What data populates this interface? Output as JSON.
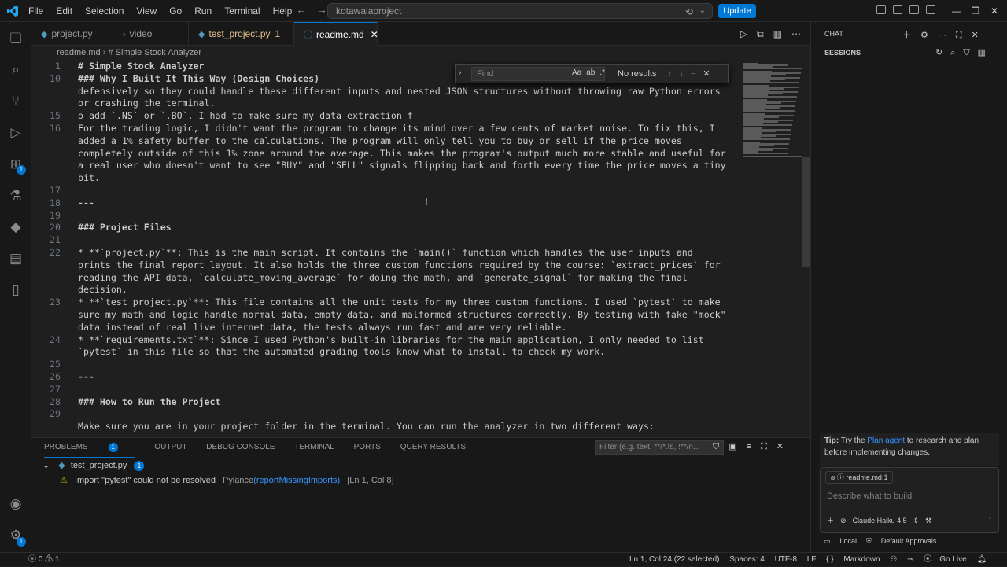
{
  "menu": [
    "File",
    "Edit",
    "Selection",
    "View",
    "Go",
    "Run",
    "Terminal",
    "Help"
  ],
  "search_text": "kotawalaproject",
  "update_label": "Update",
  "tabs": [
    {
      "label": "project.py"
    },
    {
      "label": "video"
    },
    {
      "label": "test_project.py",
      "badge": "1"
    },
    {
      "label": "readme.md"
    }
  ],
  "breadcrumb": {
    "file": "readme.md",
    "section": "# Simple Stock Analyzer"
  },
  "find": {
    "placeholder": "Find",
    "result": "No results",
    "opt_case": "Aa",
    "opt_word": "ab",
    "opt_regex": ".*"
  },
  "code_lines": [
    {
      "no": "1",
      "text": "# Simple Stock Analyzer",
      "style": "hd"
    },
    {
      "no": "10",
      "text": "### Why I Built It This Way (Design Choices)",
      "style": "hd"
    },
    {
      "no": "",
      "text": "defensively so they could handle these different inputs and nested JSON structures without throwing raw Python errors",
      "style": ""
    },
    {
      "no": "",
      "text": "or crashing the terminal.",
      "style": ""
    },
    {
      "no": "15",
      "text": "o add `.NS` or `.BO`. I had to make sure my data extraction f",
      "style": ""
    },
    {
      "no": "16",
      "text": "For the trading logic, I didn't want the program to change its mind over a few cents of market noise. To fix this, I",
      "style": ""
    },
    {
      "no": "",
      "text": "added a 1% safety buffer to the calculations. The program will only tell you to buy or sell if the price moves",
      "style": ""
    },
    {
      "no": "",
      "text": "completely outside of this 1% zone around the average. This makes the program's output much more stable and useful for",
      "style": ""
    },
    {
      "no": "",
      "text": "a real user who doesn't want to see \"BUY\" and \"SELL\" signals flipping back and forth every time the price moves a tiny",
      "style": ""
    },
    {
      "no": "",
      "text": "bit.",
      "style": ""
    },
    {
      "no": "17",
      "text": "",
      "style": ""
    },
    {
      "no": "18",
      "text": "---",
      "style": "hd"
    },
    {
      "no": "19",
      "text": "",
      "style": ""
    },
    {
      "no": "20",
      "text": "### Project Files",
      "style": "hd"
    },
    {
      "no": "21",
      "text": "",
      "style": ""
    },
    {
      "no": "22",
      "text": "* **`project.py`**: This is the main script. It contains the `main()` function which handles the user inputs and",
      "style": ""
    },
    {
      "no": "",
      "text": "prints the final report layout. It also holds the three custom functions required by the course: `extract_prices` for",
      "style": ""
    },
    {
      "no": "",
      "text": "reading the API data, `calculate_moving_average` for doing the math, and `generate_signal` for making the final",
      "style": ""
    },
    {
      "no": "",
      "text": "decision.",
      "style": ""
    },
    {
      "no": "23",
      "text": "* **`test_project.py`**: This file contains all the unit tests for my three custom functions. I used `pytest` to make",
      "style": ""
    },
    {
      "no": "",
      "text": "sure my math and logic handle normal data, empty data, and malformed structures correctly. By testing with fake \"mock\"",
      "style": ""
    },
    {
      "no": "",
      "text": "data instead of real live internet data, the tests always run fast and are very reliable.",
      "style": ""
    },
    {
      "no": "24",
      "text": "* **`requirements.txt`**: Since I used Python's built-in libraries for the main application, I only needed to list",
      "style": ""
    },
    {
      "no": "",
      "text": "`pytest` in this file so that the automated grading tools know what to install to check my work.",
      "style": ""
    },
    {
      "no": "25",
      "text": "",
      "style": ""
    },
    {
      "no": "26",
      "text": "---",
      "style": "hd"
    },
    {
      "no": "27",
      "text": "",
      "style": ""
    },
    {
      "no": "28",
      "text": "### How to Run the Project",
      "style": "hd"
    },
    {
      "no": "29",
      "text": "",
      "style": ""
    },
    {
      "no": "",
      "text": "Make sure you are in your project folder in the terminal. You can run the analyzer in two different ways:",
      "style": ""
    }
  ],
  "panel": {
    "tabs": [
      "PROBLEMS",
      "OUTPUT",
      "DEBUG CONSOLE",
      "TERMINAL",
      "PORTS",
      "QUERY RESULTS"
    ],
    "problems_count": "1",
    "filter_placeholder": "Filter (e.g. text, **/*.ts, !**/n...",
    "file": "test_project.py",
    "file_count": "1",
    "problem_message": "Import \"pytest\" could not be resolved",
    "problem_source": "Pylance",
    "problem_code": "(reportMissingImports)",
    "problem_loc": "[Ln 1, Col 8]"
  },
  "chat": {
    "title": "CHAT",
    "sessions": "SESSIONS",
    "tip_label": "Tip:",
    "tip_pre": " Try the ",
    "tip_link": "Plan agent",
    "tip_post": " to research and plan before implementing changes.",
    "context_chip": "readme.md:1",
    "input_placeholder": "Describe what to build",
    "model": "Claude Haiku 4.5",
    "footer_local": "Local",
    "footer_approvals": "Default Approvals"
  },
  "status": {
    "errors": "0",
    "warnings": "1",
    "position": "Ln 1, Col 24 (22 selected)",
    "spaces": "Spaces: 4",
    "encoding": "UTF-8",
    "eol": "LF",
    "language": "Markdown",
    "golive": "Go Live"
  }
}
